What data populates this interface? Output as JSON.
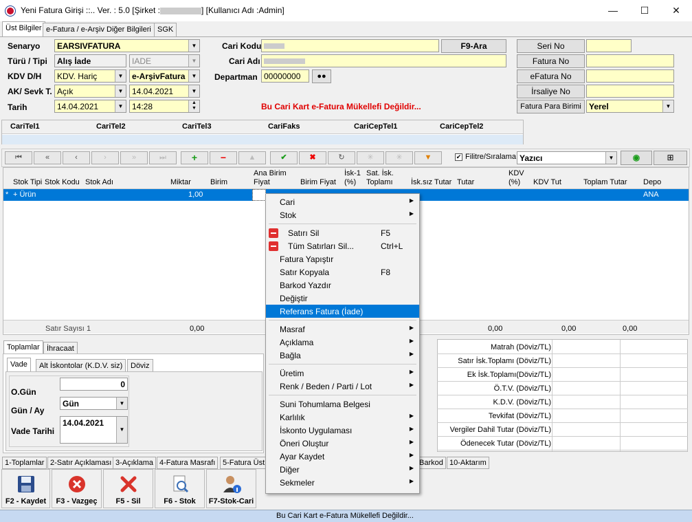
{
  "window": {
    "title": "Yeni Fatura Girişi ::.. Ver. : 5.0 [Şirket :",
    "title_suffix": "] [Kullanıcı Adı :Admin]",
    "minimize": "—",
    "maximize": "☐",
    "close": "✕"
  },
  "tabs": [
    "Üst Bilgiler",
    "e-Fatura / e-Arşiv Diğer Bilgileri",
    "SGK"
  ],
  "form": {
    "senaryo_label": "Senaryo",
    "senaryo": "EARSIVFATURA",
    "turu_label": "Türü / Tipi",
    "turu": "Alış İade",
    "tipi": "IADE",
    "kdv_label": "KDV D/H",
    "kdv": "KDV. Hariç",
    "belge": "e-ArşivFatura",
    "ak_label": "AK/ Sevk T.",
    "ak": "Açık",
    "sevk": "14.04.2021",
    "tarih_label": "Tarih",
    "tarih": "14.04.2021",
    "saat": "14:28",
    "cari_kodu_label": "Cari Kodu",
    "cari_adi_label": "Cari Adı",
    "departman_label": "Departman",
    "departman": "00000000",
    "ara_btn": "F9-Ara",
    "warning": "Bu Cari Kart e-Fatura Mükellefi Değildir...",
    "seri_no": "Seri No",
    "fatura_no": "Fatura No",
    "efatura_no": "eFatura No",
    "irsaliye_no": "İrsaliye No",
    "para_birimi": "Fatura Para Birimi",
    "para_value": "Yerel"
  },
  "contact_cols": [
    "CariTel1",
    "CariTel2",
    "CariTel3",
    "CariFaks",
    "CariCepTel1",
    "CariCepTel2"
  ],
  "toolbar": {
    "filter_label": "Filitre/Sıralama",
    "printer": "Yazıcı"
  },
  "grid": {
    "cols": [
      "Stok Tipi",
      "Stok Kodu",
      "Stok Adı",
      "Miktar",
      "Birim",
      "Ana Birim Fiyat",
      "Birim Fiyat",
      "İsk-1 (%)",
      "Sat. İsk. Toplamı",
      "İsk.sız Tutar",
      "Tutar",
      "KDV (%)",
      "KDV Tut",
      "Toplam Tutar",
      "Depo"
    ],
    "row": {
      "tip": "+ Ürün",
      "miktar": "1,00",
      "depo": "ANA"
    },
    "footer": {
      "satir_sayisi": "Satır Sayısı",
      "count": "1",
      "v1": "0,00",
      "v2": "0,00",
      "v3": "0,00",
      "v4": "0,00"
    }
  },
  "menu": [
    {
      "label": "Cari",
      "arrow": true
    },
    {
      "label": "Stok",
      "arrow": true
    },
    {
      "sep": true
    },
    {
      "label": "Satırı Sil",
      "key": "F5",
      "icon": "red"
    },
    {
      "label": "Tüm Satırları Sil...",
      "key": "Ctrl+L",
      "icon": "red"
    },
    {
      "label": "Fatura Yapıştır"
    },
    {
      "label": "Satır Kopyala",
      "key": "F8"
    },
    {
      "label": "Barkod Yazdır"
    },
    {
      "label": "Değiştir"
    },
    {
      "label": "Referans Fatura (İade)",
      "selected": true
    },
    {
      "sep": true
    },
    {
      "label": "Masraf",
      "arrow": true
    },
    {
      "label": "Açıklama",
      "arrow": true
    },
    {
      "label": "Bağla",
      "arrow": true
    },
    {
      "sep": true
    },
    {
      "label": "Üretim",
      "arrow": true
    },
    {
      "label": "Renk / Beden / Parti / Lot",
      "arrow": true
    },
    {
      "sep": true
    },
    {
      "label": "Suni Tohumlama Belgesi"
    },
    {
      "label": "Karlılık",
      "arrow": true
    },
    {
      "label": "İskonto Uygulaması",
      "arrow": true
    },
    {
      "label": "Öneri Oluştur",
      "arrow": true
    },
    {
      "label": "Ayar Kaydet",
      "arrow": true
    },
    {
      "label": "Diğer",
      "arrow": true
    },
    {
      "label": "Sekmeler",
      "arrow": true
    }
  ],
  "lower": {
    "tabs": [
      "Toplamlar",
      "İhracaat"
    ],
    "subtabs": [
      "Vade",
      "Alt İskontolar (K.D.V. siz)",
      "Döviz"
    ],
    "ogun_label": "O.Gün",
    "ogun": "0",
    "gunay_label": "Gün / Ay",
    "gunay": "Gün",
    "vade_label": "Vade Tarihi",
    "vade": "14.04.2021"
  },
  "totals": [
    "Matrah (Döviz/TL)",
    "Satır İsk.Toplamı (Döviz/TL)",
    "Ek İsk.Toplamı(Döviz/TL)",
    "Ö.T.V. (Döviz/TL)",
    "K.D.V. (Döviz/TL)",
    "Tevkifat (Döviz/TL)",
    "Vergiler Dahil Tutar (Döviz/TL)",
    "Ödenecek Tutar (Döviz/TL)"
  ],
  "bottom_tabs": [
    "1-Toplamlar",
    "2-Satır Açıklaması",
    "3-Açıklama",
    "4-Fatura Masrafı",
    "5-Fatura Üst",
    "Barkod",
    "10-Aktarım"
  ],
  "buttons": [
    "F2 - Kaydet",
    "F3 - Vazgeç",
    "F5 - Sil",
    "F6 - Stok",
    "F7-Stok-Cari"
  ],
  "status": "Bu Cari Kart e-Fatura Mükellefi Değildir..."
}
